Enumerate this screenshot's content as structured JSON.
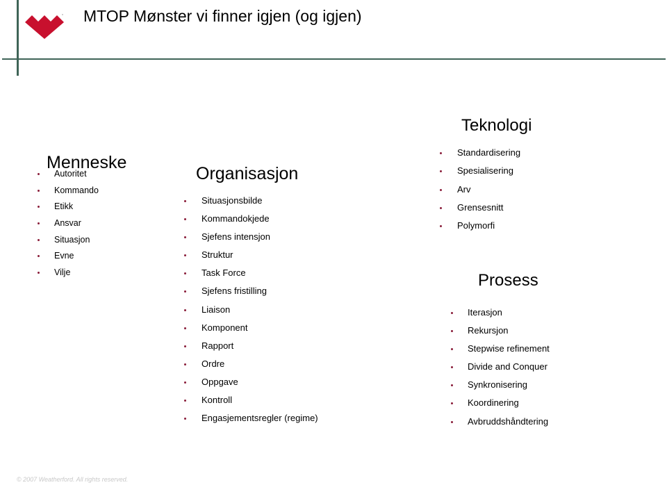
{
  "slide": {
    "title": "MTOP Mønster vi finner igjen (og igjen)",
    "logo_icon": "weatherford-logo-icon",
    "brand_color": "#c8102e",
    "bullet_color": "#8a1d3a",
    "rule_color": "#3f6457"
  },
  "sections": {
    "menneske": {
      "heading": "Menneske",
      "items": [
        "Autoritet",
        "Kommando",
        "Etikk",
        "Ansvar",
        "Situasjon",
        "Evne",
        "Vilje"
      ]
    },
    "organisasjon": {
      "heading": "Organisasjon",
      "items": [
        "Situasjonsbilde",
        "Kommandokjede",
        "Sjefens intensjon",
        "Struktur",
        "Task Force",
        "Sjefens fristilling",
        "Liaison",
        "Komponent",
        "Rapport",
        "Ordre",
        "Oppgave",
        "Kontroll",
        "Engasjementsregler (regime)"
      ]
    },
    "teknologi": {
      "heading": "Teknologi",
      "items": [
        "Standardisering",
        "Spesialisering",
        "Arv",
        "Grensesnitt",
        "Polymorfi"
      ]
    },
    "prosess": {
      "heading": "Prosess",
      "items": [
        "Iterasjon",
        "Rekursjon",
        "Stepwise refinement",
        "Divide and Conquer",
        "Synkronisering",
        "Koordinering",
        "Avbruddshåndtering"
      ]
    }
  },
  "footer": {
    "copyright": "© 2007 Weatherford. All rights reserved."
  }
}
